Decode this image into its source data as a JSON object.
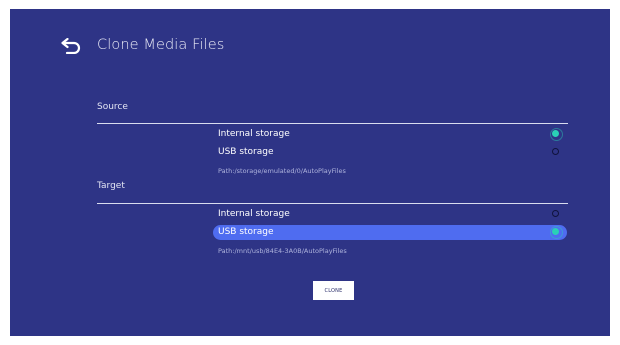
{
  "header": {
    "title": "Clone Media Files",
    "back_icon": "back-arrow-icon"
  },
  "source": {
    "label": "Source",
    "options": [
      {
        "label": "Internal storage",
        "selected": true
      },
      {
        "label": "USB storage",
        "selected": false
      }
    ],
    "path": "Path:/storage/emulated/0/AutoPlayFiles"
  },
  "target": {
    "label": "Target",
    "options": [
      {
        "label": "Internal storage",
        "selected": false
      },
      {
        "label": "USB storage",
        "selected": true
      }
    ],
    "path": "Path:/mnt/usb/84E4-3A0B/AutoPlayFiles"
  },
  "actions": {
    "clone_label": "CLONE"
  },
  "colors": {
    "background": "#2e3486",
    "highlight": "#4f6cf0",
    "radio_selected": "#2ad1b6"
  }
}
